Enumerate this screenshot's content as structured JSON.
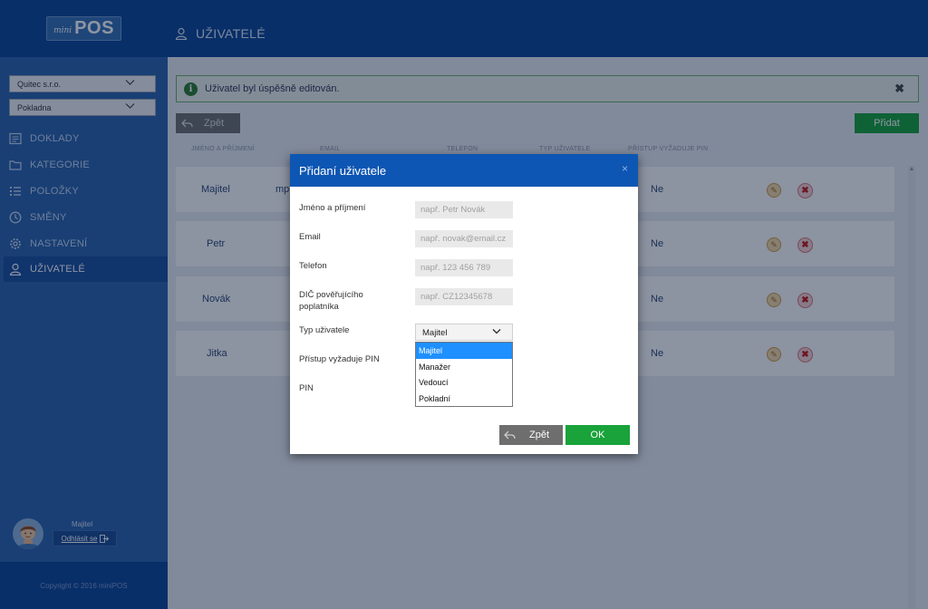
{
  "app": {
    "logo_mini": "mini",
    "logo_pos": "POS",
    "page_title": "UŽIVATELÉ"
  },
  "sidebar": {
    "company_select": "Quitec s.r.o.",
    "register_select": "Pokladna",
    "items": [
      {
        "label": "DOKLADY",
        "icon": "document-icon"
      },
      {
        "label": "KATEGORIE",
        "icon": "folder-icon"
      },
      {
        "label": "POLOŽKY",
        "icon": "list-icon"
      },
      {
        "label": "SMĚNY",
        "icon": "clock-icon"
      },
      {
        "label": "NASTAVENÍ",
        "icon": "gear-icon"
      },
      {
        "label": "UŽIVATELÉ",
        "icon": "user-icon",
        "active": true
      }
    ],
    "user_role": "Majitel",
    "logout_label": "Odhlásit se",
    "copyright": "Copyright © 2016 miniPOS"
  },
  "main": {
    "alert_text": "Uživatel byl úspěšně editován.",
    "back_label": "Zpět",
    "add_label": "Přidat",
    "columns": [
      "JMÉNO A PŘÍJMENÍ",
      "EMAIL",
      "TELEFON",
      "TYP UŽIVATELE",
      "PŘÍSTUP VYŽADUJE PIN"
    ],
    "rows": [
      {
        "name": "Majitel",
        "email": "mp",
        "pin": "Ne"
      },
      {
        "name": "Petr",
        "email": "",
        "pin": "Ne"
      },
      {
        "name": "Novák",
        "email": "",
        "pin": "Ne"
      },
      {
        "name": "Jitka",
        "email": "",
        "pin": "Ne"
      }
    ]
  },
  "modal": {
    "title": "Přidaní uživatele",
    "close_symbol": "×",
    "fields": {
      "name_label": "Jméno a příjmení",
      "name_placeholder": "např. Petr Novák",
      "email_label": "Email",
      "email_placeholder": "např. novak@email.cz",
      "phone_label": "Telefon",
      "phone_placeholder": "např. 123 456 789",
      "dic_label_line1": "DIČ pověřujícího",
      "dic_label_line2": "poplatníka",
      "dic_placeholder": "např. CZ12345678",
      "type_label": "Typ uživatele",
      "type_value": "Majitel",
      "pin_access_label": "Přístup vyžaduje PIN",
      "pin_label": "PIN"
    },
    "type_options": [
      "Majitel",
      "Manažer",
      "Vedoucí",
      "Pokladní"
    ],
    "back_label": "Zpět",
    "ok_label": "OK"
  },
  "colors": {
    "primary": "#0e4596",
    "sidebar": "#2b63ac",
    "success": "#19a33a",
    "modal_header": "#0e56b3",
    "option_selected": "#1e90ff"
  }
}
